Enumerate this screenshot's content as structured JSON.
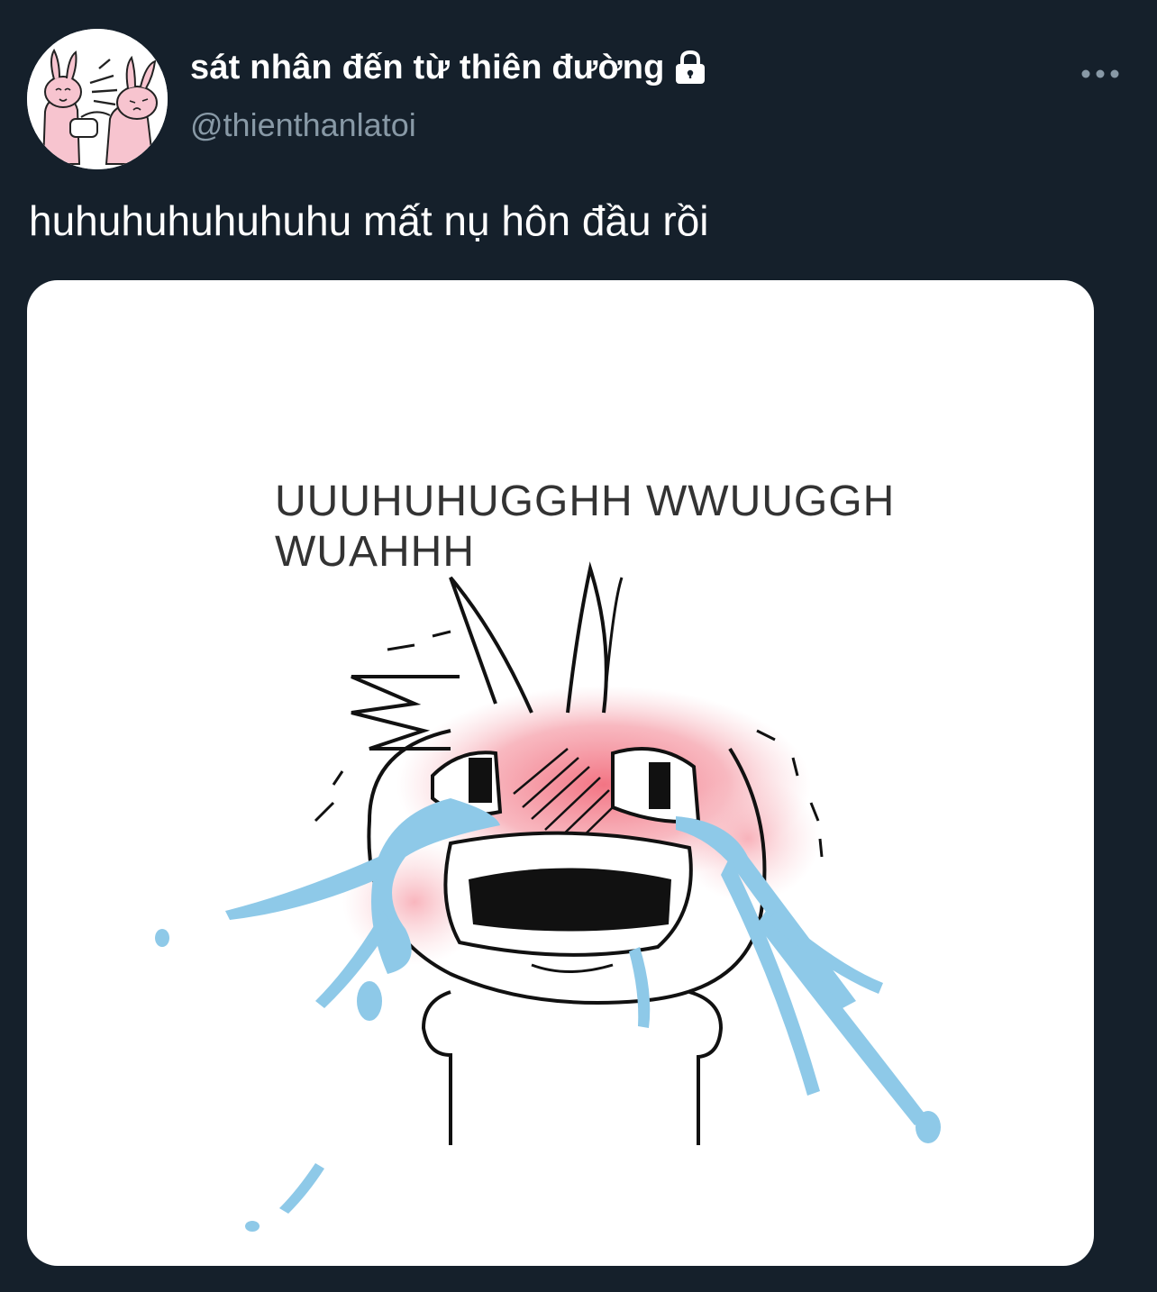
{
  "tweet": {
    "display_name": "sát nhân đến từ thiên đường",
    "handle": "@thienthanlatoi",
    "text": "huhuhuhuhuhuhu mất nụ hôn đầu rồi",
    "protected_icon": "lock-icon",
    "more_icon": "more-horizontal-icon",
    "avatar_icon": "pink-bunny-avatar"
  },
  "media": {
    "caption_line1": "UUUHUHUGGHH WWUUGGH",
    "caption_line2": "WUAHHH",
    "illustration": "crying-bunny-illustration"
  },
  "colors": {
    "background": "#15202b",
    "text_primary": "#ffffff",
    "text_secondary": "#8899a6",
    "media_background": "#ffffff",
    "tears": "#8ec9e8",
    "blush": "#f28b95"
  }
}
